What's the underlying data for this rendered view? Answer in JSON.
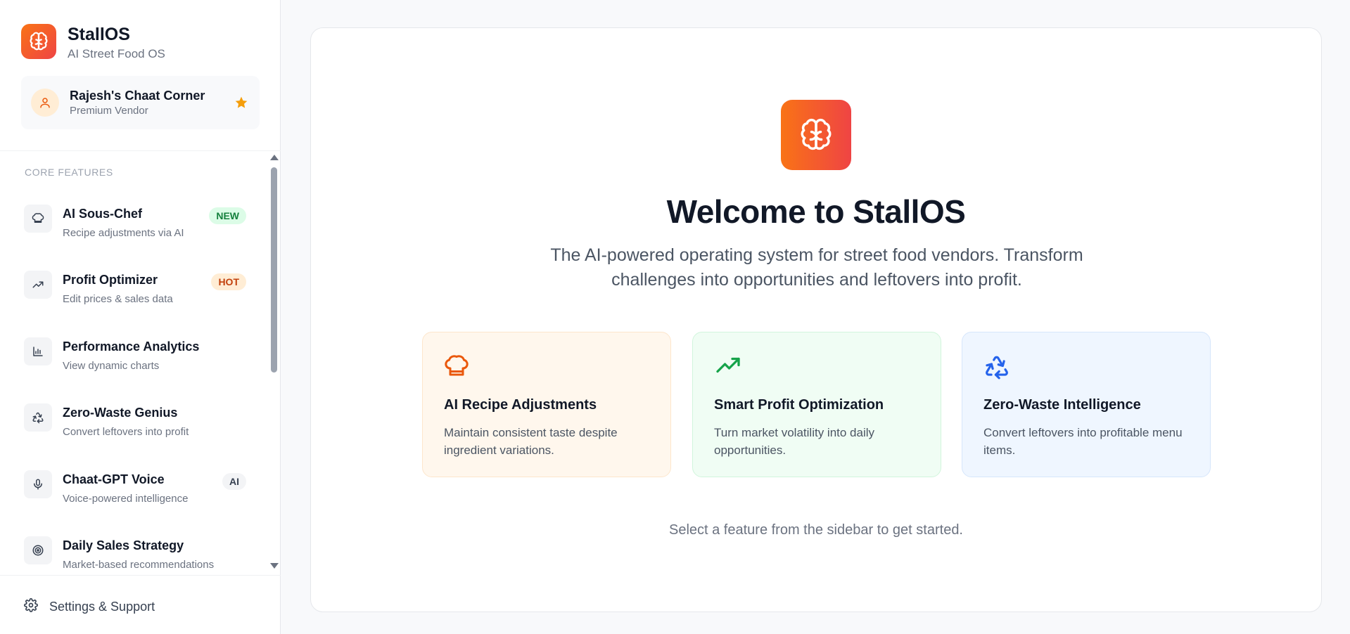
{
  "brand": {
    "name": "StallOS",
    "subtitle": "AI Street Food OS",
    "icon": "brain-icon",
    "gradient": [
      "#f97316",
      "#ef4444"
    ]
  },
  "vendor": {
    "name": "Rajesh's Chaat Corner",
    "tier": "Premium Vendor",
    "avatar_icon": "user-icon",
    "star_icon": "star-icon",
    "star_color": "#f59e0b"
  },
  "sidebar": {
    "section_label": "CORE FEATURES",
    "items": [
      {
        "title": "AI Sous-Chef",
        "desc": "Recipe adjustments via AI",
        "badge": "NEW",
        "icon": "chef-hat-icon"
      },
      {
        "title": "Profit Optimizer",
        "desc": "Edit prices & sales data",
        "badge": "HOT",
        "icon": "trending-up-icon"
      },
      {
        "title": "Performance Analytics",
        "desc": "View dynamic charts",
        "badge": "",
        "icon": "bar-chart-icon"
      },
      {
        "title": "Zero-Waste Genius",
        "desc": "Convert leftovers into profit",
        "badge": "",
        "icon": "recycle-icon"
      },
      {
        "title": "Chaat-GPT Voice",
        "desc": "Voice-powered intelligence",
        "badge": "AI",
        "icon": "microphone-icon"
      },
      {
        "title": "Daily Sales Strategy",
        "desc": "Market-based recommendations",
        "badge": "",
        "icon": "target-icon"
      }
    ],
    "settings_label": "Settings & Support"
  },
  "main": {
    "title": "Welcome to StallOS",
    "tagline": "The AI-powered operating system for street food vendors. Transform challenges into opportunities and leftovers into profit.",
    "features": [
      {
        "title": "AI Recipe Adjustments",
        "desc": "Maintain consistent taste despite ingredient variations.",
        "icon": "chef-hat-icon",
        "color": "#ea580c"
      },
      {
        "title": "Smart Profit Optimization",
        "desc": "Turn market volatility into daily opportunities.",
        "icon": "trending-up-icon",
        "color": "#16a34a"
      },
      {
        "title": "Zero-Waste Intelligence",
        "desc": "Convert leftovers into profitable menu items.",
        "icon": "recycle-icon",
        "color": "#2563eb"
      }
    ],
    "hint": "Select a feature from the sidebar to get started."
  }
}
